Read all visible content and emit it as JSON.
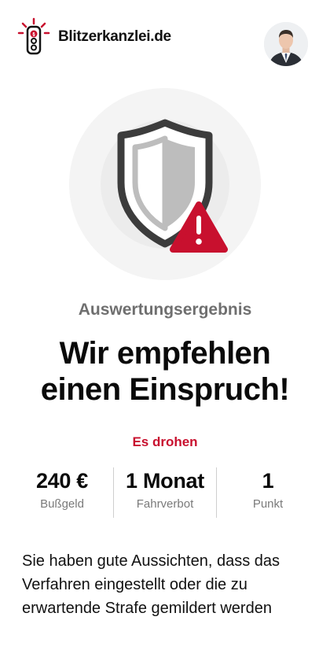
{
  "header": {
    "brand": "Blitzerkanzlei.de",
    "logo_icon": "traffic-light-icon",
    "avatar_icon": "lawyer-avatar"
  },
  "hero": {
    "icon": "shield-warning-icon",
    "accent_color": "#c8102e"
  },
  "result": {
    "subtitle": "Auswertungsergebnis",
    "headline": "Wir empfehlen einen Einspruch!",
    "threat_label": "Es drohen"
  },
  "stats": [
    {
      "value": "240 €",
      "label": "Bußgeld"
    },
    {
      "value": "1 Monat",
      "label": "Fahrverbot"
    },
    {
      "value": "1",
      "label": "Punkt"
    }
  ],
  "description": "Sie haben gute Aussichten, dass das Verfahren eingestellt oder die zu erwartende Strafe gemildert werden"
}
